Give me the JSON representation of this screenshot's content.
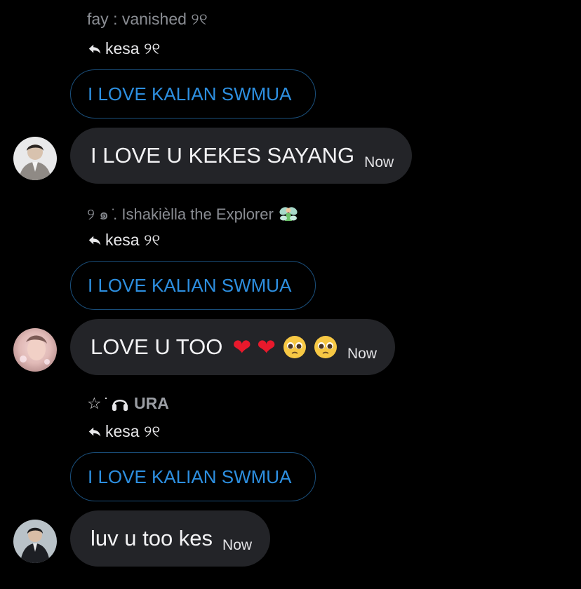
{
  "threads": [
    {
      "sender_name": "fay : vanished ୨୧",
      "reply_to": "kesa ୨୧",
      "quoted_text": "I LOVE KALIAN SWMUA",
      "message": "I LOVE U KEKES SAYANG",
      "time": "Now",
      "avatar_icon": "avatar-boy-grey-jacket"
    },
    {
      "sender_name": "୨ ๑ ̇. Ishakièlla the Explorer",
      "sender_emoji": "fairy-icon",
      "reply_to": "kesa ୨୧",
      "quoted_text": "I LOVE KALIAN SWMUA",
      "message": "LOVE U TOO",
      "message_emojis": [
        "red-heart",
        "red-heart",
        "pleading-face",
        "pleading-face"
      ],
      "time": "Now",
      "avatar_icon": "avatar-pink-blurry"
    },
    {
      "sender_prefix": "☆ ̇",
      "sender_name": "URA",
      "sender_emoji": "headphones-icon",
      "reply_to": "kesa ୨୧",
      "quoted_text": "I LOVE KALIAN SWMUA",
      "message": "luv u too kes",
      "time": "Now",
      "avatar_icon": "avatar-man-dark-suit"
    }
  ],
  "colors": {
    "background": "#000000",
    "quote_text": "#2d8fe0",
    "quote_border": "#1a4f7c",
    "bubble": "#232428",
    "sender": "#8a8d93"
  }
}
